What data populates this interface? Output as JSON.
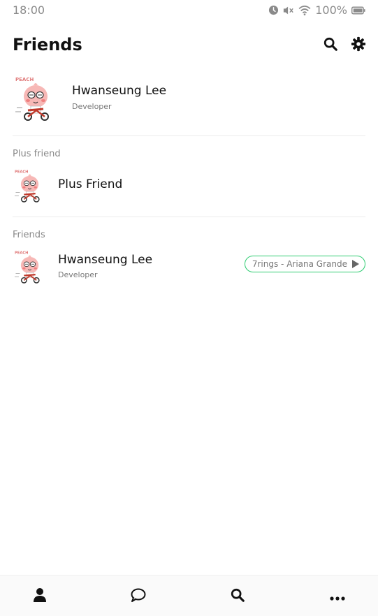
{
  "status_bar": {
    "time": "18:00",
    "battery_text": "100%",
    "icons": [
      "alarm-icon",
      "mute-icon",
      "wifi-icon",
      "battery-icon"
    ]
  },
  "header": {
    "title": "Friends",
    "icons": [
      "search-icon",
      "gear-icon"
    ]
  },
  "profile": {
    "name": "Hwanseung Lee",
    "status": "Developer",
    "avatar_caption": "PEACH"
  },
  "sections": {
    "plus_friend": {
      "label": "Plus friend",
      "items": [
        {
          "name": "Plus Friend",
          "avatar_caption": "PEACH"
        }
      ]
    },
    "friends": {
      "label": "Friends",
      "items": [
        {
          "name": "Hwanseung Lee",
          "status": "Developer",
          "music": "7rings - Ariana Grande",
          "avatar_caption": "PEACH"
        }
      ]
    }
  },
  "tabbar": {
    "tabs": [
      "person-icon",
      "chat-icon",
      "search-icon",
      "more-icon"
    ],
    "active_color": "#111111"
  },
  "colors": {
    "accent_green": "#2ecc71",
    "avatar_pink": "#f7b8b6",
    "bike_red": "#c0392b"
  }
}
